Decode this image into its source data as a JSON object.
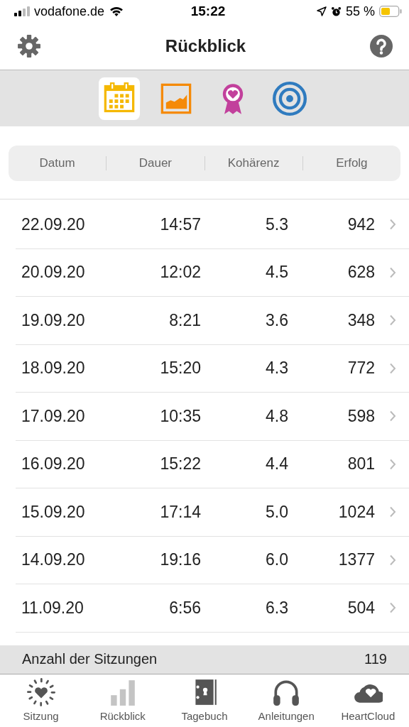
{
  "status_bar": {
    "carrier": "vodafone.de",
    "time": "15:22",
    "battery": "55 %"
  },
  "nav": {
    "title": "Rückblick"
  },
  "view_tabs": [
    {
      "kind": "calendar",
      "selected": true
    },
    {
      "kind": "chart",
      "selected": false
    },
    {
      "kind": "award",
      "selected": false
    },
    {
      "kind": "target",
      "selected": false
    }
  ],
  "columns": [
    "Datum",
    "Dauer",
    "Kohärenz",
    "Erfolg"
  ],
  "rows": [
    {
      "date": "22.09.20",
      "duration": "14:57",
      "coherence": "5.3",
      "success": "942"
    },
    {
      "date": "20.09.20",
      "duration": "12:02",
      "coherence": "4.5",
      "success": "628"
    },
    {
      "date": "19.09.20",
      "duration": "8:21",
      "coherence": "3.6",
      "success": "348"
    },
    {
      "date": "18.09.20",
      "duration": "15:20",
      "coherence": "4.3",
      "success": "772"
    },
    {
      "date": "17.09.20",
      "duration": "10:35",
      "coherence": "4.8",
      "success": "598"
    },
    {
      "date": "16.09.20",
      "duration": "15:22",
      "coherence": "4.4",
      "success": "801"
    },
    {
      "date": "15.09.20",
      "duration": "17:14",
      "coherence": "5.0",
      "success": "1024"
    },
    {
      "date": "14.09.20",
      "duration": "19:16",
      "coherence": "6.0",
      "success": "1377"
    },
    {
      "date": "11.09.20",
      "duration": "6:56",
      "coherence": "6.3",
      "success": "504"
    }
  ],
  "summary": {
    "label": "Anzahl der Sitzungen",
    "value": "119"
  },
  "tab_bar": [
    {
      "kind": "session",
      "label": "Sitzung",
      "selected": false
    },
    {
      "kind": "review",
      "label": "Rückblick",
      "selected": true
    },
    {
      "kind": "journal",
      "label": "Tagebuch",
      "selected": false
    },
    {
      "kind": "guides",
      "label": "Anleitungen",
      "selected": false
    },
    {
      "kind": "cloud",
      "label": "HeartCloud",
      "selected": false
    }
  ]
}
